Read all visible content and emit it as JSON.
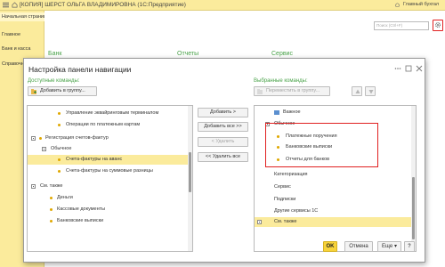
{
  "window": {
    "title": "[КОПИЯ] ШЕРСТ ОЛЬГА ВЛАДИМИРОВНА  (1С:Предприятие)",
    "user": "Главный бухгал"
  },
  "sidebar": {
    "items": [
      {
        "label": "Начальная страница"
      },
      {
        "label": "Главное"
      },
      {
        "label": "Банк и касса"
      },
      {
        "label": "Справочники"
      }
    ]
  },
  "main": {
    "search_placeholder": "Поиск (Ctrl+F)",
    "sections": [
      {
        "label": "Банк"
      },
      {
        "label": "Отчеты"
      },
      {
        "label": "Сервис"
      }
    ]
  },
  "dialog": {
    "title": "Настройка панели навигации",
    "available_label": "Доступные команды:",
    "selected_label": "Выбранные команды:",
    "add_to_group_button": "Добавить в группу...",
    "move_to_group_button": "Переместить в группу...",
    "available_items": [
      {
        "label": "Управление эквайринговым терминалом",
        "kind": "item"
      },
      {
        "label": "Операции по платежным картам",
        "kind": "item"
      },
      {
        "label": "Регистрация счетов-фактур",
        "kind": "group"
      },
      {
        "label": "Обычное",
        "kind": "subgroup"
      },
      {
        "label": "Счета-фактуры на аванс",
        "kind": "item",
        "selected": true
      },
      {
        "label": "Счета-фактуры на суммовые разницы",
        "kind": "item"
      },
      {
        "label": "См. также",
        "kind": "group"
      },
      {
        "label": "Деньги",
        "kind": "item"
      },
      {
        "label": "Кассовые документы",
        "kind": "item"
      },
      {
        "label": "Банковские выписки",
        "kind": "item"
      }
    ],
    "middle_buttons": {
      "add": "Добавить >",
      "add_all": "Добавить все >>",
      "remove": "< Удалить",
      "remove_all": "<< Удалить все"
    },
    "selected_items": [
      {
        "label": "Важное",
        "kind": "icon-item"
      },
      {
        "label": "Обычное",
        "kind": "subgroup"
      },
      {
        "label": "Платежные поручения",
        "kind": "item"
      },
      {
        "label": "Банковские выписки",
        "kind": "item"
      },
      {
        "label": "Отчеты для банков",
        "kind": "item"
      },
      {
        "label": "Категоризация",
        "kind": "plain"
      },
      {
        "label": "Сервис",
        "kind": "plain"
      },
      {
        "label": "Подписки",
        "kind": "plain"
      },
      {
        "label": "Другие сервисы 1С",
        "kind": "plain"
      },
      {
        "label": "См. также",
        "kind": "group",
        "selected": true
      }
    ],
    "footer": {
      "ok": "OK",
      "cancel": "Отмена",
      "more": "Еще",
      "help": "?"
    }
  },
  "colors": {
    "accent": "#fbeb9c",
    "section_green": "#4aa34a",
    "highlight_red": "#e02020",
    "ok_yellow": "#f7d33a"
  }
}
